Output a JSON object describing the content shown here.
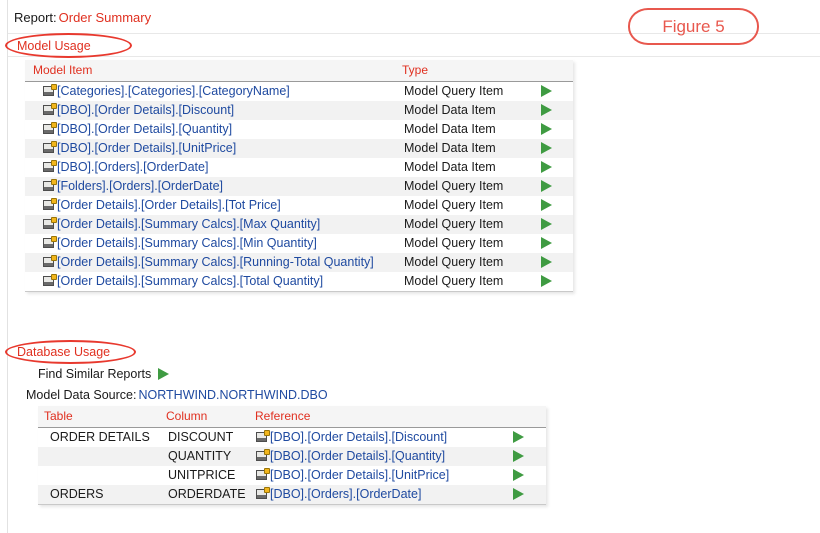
{
  "report": {
    "label": "Report:",
    "name": "Order Summary"
  },
  "annotation": {
    "figure_label": "Figure 5",
    "color": "#e8584e"
  },
  "sections": {
    "model_usage": {
      "label": "Model Usage",
      "headers": {
        "item": "Model Item",
        "type": "Type"
      },
      "rows": [
        {
          "item": "[Categories].[Categories].[CategoryName]",
          "type": "Model Query Item",
          "action": "go-arrow-icon"
        },
        {
          "item": "[DBO].[Order Details].[Discount]",
          "type": "Model Data Item",
          "action": "go-arrow-icon"
        },
        {
          "item": "[DBO].[Order Details].[Quantity]",
          "type": "Model Data Item",
          "action": "go-arrow-icon"
        },
        {
          "item": "[DBO].[Order Details].[UnitPrice]",
          "type": "Model Data Item",
          "action": "go-arrow-icon"
        },
        {
          "item": "[DBO].[Orders].[OrderDate]",
          "type": "Model Data Item",
          "action": "go-arrow-icon"
        },
        {
          "item": "[Folders].[Orders].[OrderDate]",
          "type": "Model Query Item",
          "action": "go-arrow-icon"
        },
        {
          "item": "[Order Details].[Order Details].[Tot Price]",
          "type": "Model Query Item",
          "action": "go-arrow-icon"
        },
        {
          "item": "[Order Details].[Summary Calcs].[Max Quantity]",
          "type": "Model Query Item",
          "action": "go-arrow-icon"
        },
        {
          "item": "[Order Details].[Summary Calcs].[Min Quantity]",
          "type": "Model Query Item",
          "action": "go-arrow-icon"
        },
        {
          "item": "[Order Details].[Summary Calcs].[Running-Total Quantity]",
          "type": "Model Query Item",
          "action": "go-arrow-icon"
        },
        {
          "item": "[Order Details].[Summary Calcs].[Total Quantity]",
          "type": "Model Query Item",
          "action": "go-arrow-icon"
        }
      ]
    },
    "database_usage": {
      "label": "Database Usage",
      "find_similar_reports": "Find Similar Reports",
      "data_source_label": "Model Data Source:",
      "data_source_value": "NORTHWIND.NORTHWIND.DBO",
      "headers": {
        "table": "Table",
        "column": "Column",
        "reference": "Reference"
      },
      "rows": [
        {
          "table": "ORDER DETAILS",
          "column": "DISCOUNT",
          "reference": "[DBO].[Order Details].[Discount]",
          "action": "go-arrow-icon"
        },
        {
          "table": "",
          "column": "QUANTITY",
          "reference": "[DBO].[Order Details].[Quantity]",
          "action": "go-arrow-icon"
        },
        {
          "table": "",
          "column": "UNITPRICE",
          "reference": "[DBO].[Order Details].[UnitPrice]",
          "action": "go-arrow-icon"
        },
        {
          "table": "ORDERS",
          "column": "ORDERDATE",
          "reference": "[DBO].[Orders].[OrderDate]",
          "action": "go-arrow-icon"
        }
      ]
    }
  },
  "colors": {
    "header_text": "#e03020",
    "link_text": "#1f4aa0",
    "arrow_green": "#3f9b42",
    "annotation_red": "#e8392e"
  }
}
